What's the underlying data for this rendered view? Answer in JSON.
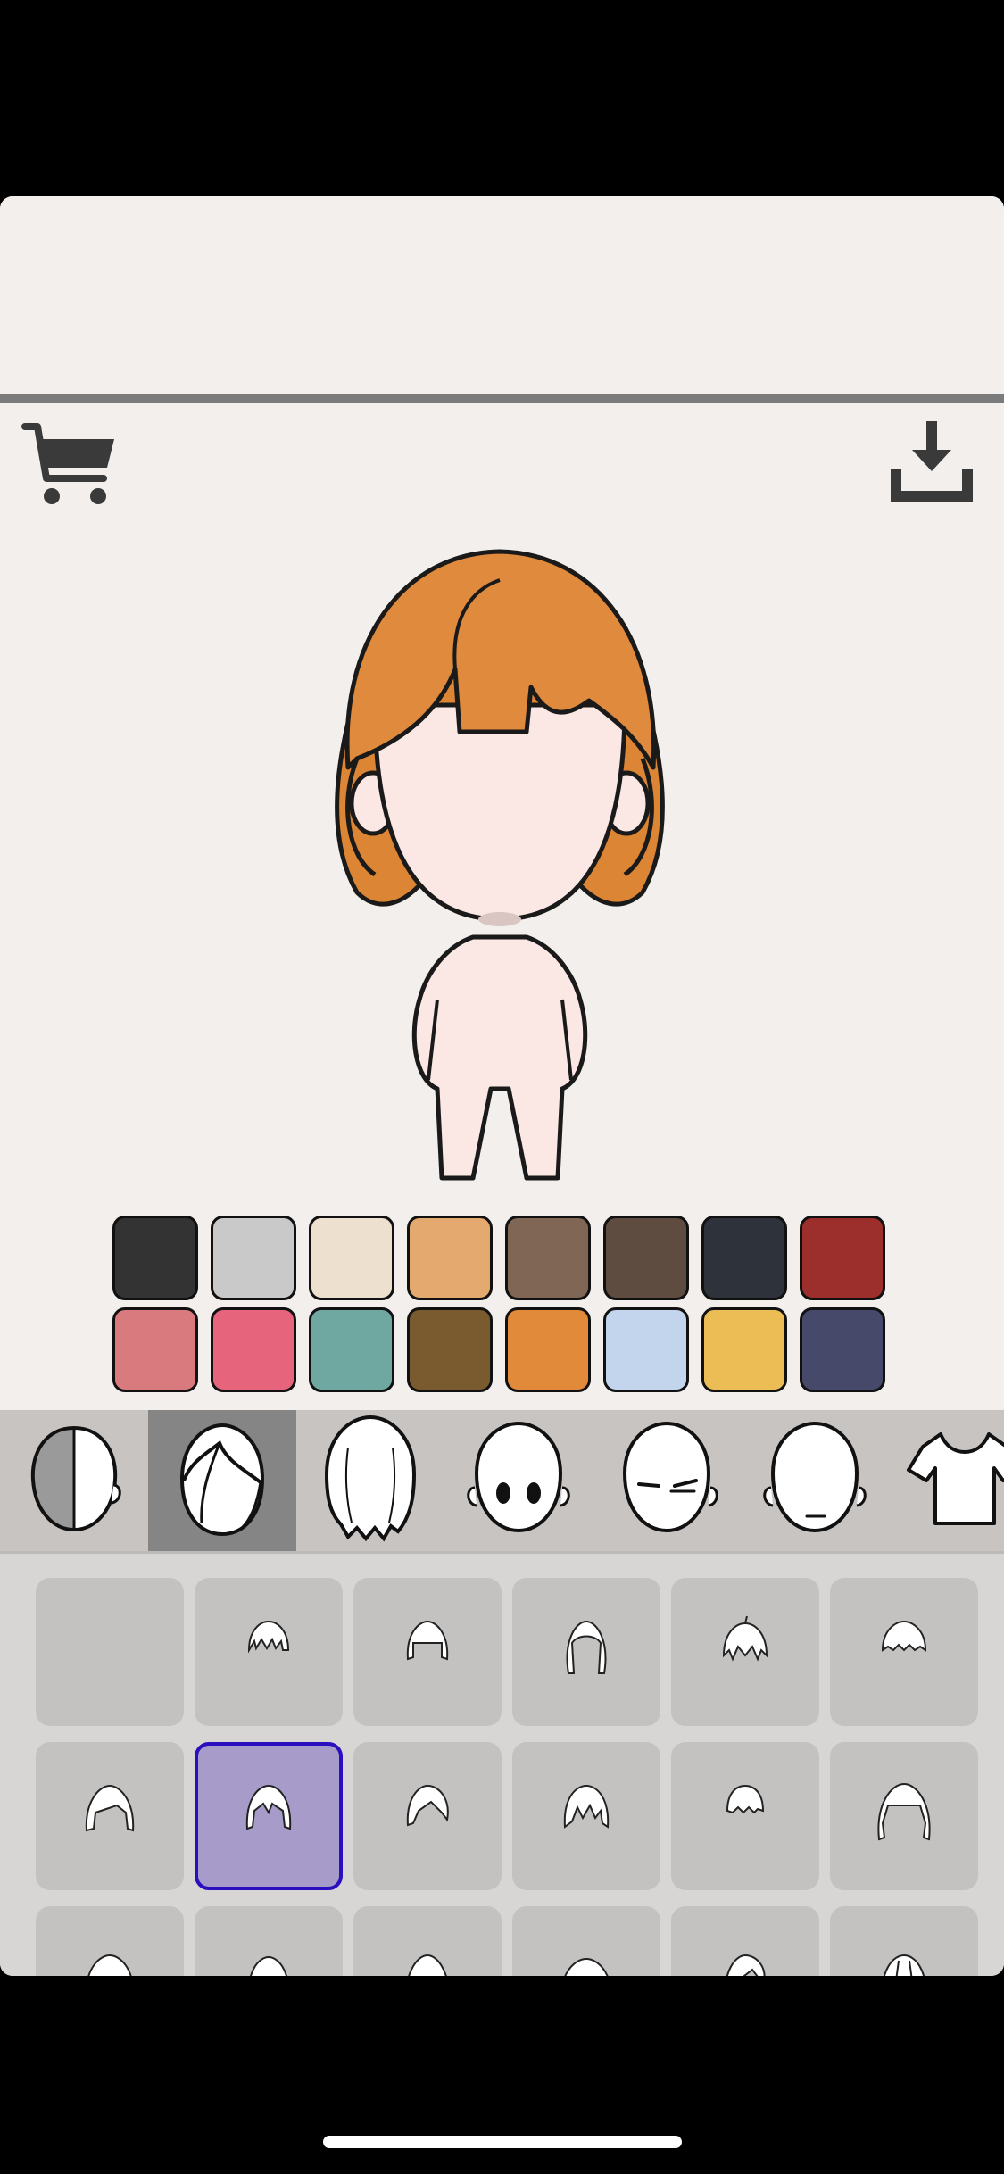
{
  "toolbar": {
    "cart_icon": "shopping-cart-icon",
    "download_icon": "download-icon"
  },
  "colors": {
    "background": "#f2efec",
    "hair": "#e08a3e",
    "skin": "#fbe8e4",
    "selected_cell": "#a79cc9",
    "selected_border": "#2a0fbf"
  },
  "palette": [
    "#333333",
    "#c9c9c9",
    "#ede0cf",
    "#e3a96f",
    "#806655",
    "#5e4c41",
    "#2e323b",
    "#9c2f2c",
    "#d97a7e",
    "#e6647c",
    "#6ea8a0",
    "#7a5b30",
    "#e18a3a",
    "#c3d5ed",
    "#ebbd54",
    "#464969"
  ],
  "category_tabs": [
    {
      "name": "skin-tone",
      "icon": "half-shaded-head-icon",
      "selected": false
    },
    {
      "name": "front-hair",
      "icon": "bangs-hair-icon",
      "selected": true
    },
    {
      "name": "back-hair",
      "icon": "back-hair-icon",
      "selected": false
    },
    {
      "name": "eyes",
      "icon": "eyes-icon",
      "selected": false
    },
    {
      "name": "eyebrows",
      "icon": "eyebrows-icon",
      "selected": false
    },
    {
      "name": "mouth",
      "icon": "mouth-icon",
      "selected": false
    },
    {
      "name": "clothes",
      "icon": "tshirt-icon",
      "selected": false
    }
  ],
  "hair_options": {
    "rows": 3,
    "columns": 6,
    "selected_index": 7,
    "empty_index": 0
  }
}
